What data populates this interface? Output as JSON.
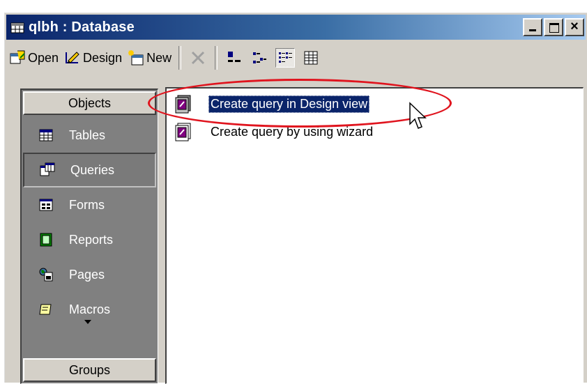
{
  "window": {
    "title": "qlbh : Database",
    "buttons": {
      "minimize": "_",
      "maximize": "□",
      "close": "×"
    }
  },
  "toolbar": {
    "open_label": "Open",
    "design_label": "Design",
    "new_label": "New",
    "icons": [
      "open-icon",
      "design-icon",
      "new-icon",
      "delete-icon",
      "large-icons-view-icon",
      "small-icons-view-icon",
      "list-view-icon",
      "details-view-icon"
    ],
    "active_view": "list"
  },
  "objects_bar": {
    "header": "Objects",
    "footer": "Groups",
    "items": [
      {
        "label": "Tables",
        "icon": "table-icon",
        "selected": false
      },
      {
        "label": "Queries",
        "icon": "query-icon",
        "selected": true
      },
      {
        "label": "Forms",
        "icon": "form-icon",
        "selected": false
      },
      {
        "label": "Reports",
        "icon": "report-icon",
        "selected": false
      },
      {
        "label": "Pages",
        "icon": "page-icon",
        "selected": false
      },
      {
        "label": "Macros",
        "icon": "macro-icon",
        "selected": false
      }
    ]
  },
  "list": {
    "items": [
      {
        "label": "Create query in Design view",
        "icon": "create-query-design-icon",
        "selected": true
      },
      {
        "label": "Create query by using wizard",
        "icon": "create-query-wizard-icon",
        "selected": false
      }
    ]
  },
  "colors": {
    "titlebar_start": "#0a246a",
    "titlebar_end": "#a6caf0",
    "selection": "#0a246a",
    "annotation": "#e0141e",
    "objects_bar_bg": "#808080"
  }
}
